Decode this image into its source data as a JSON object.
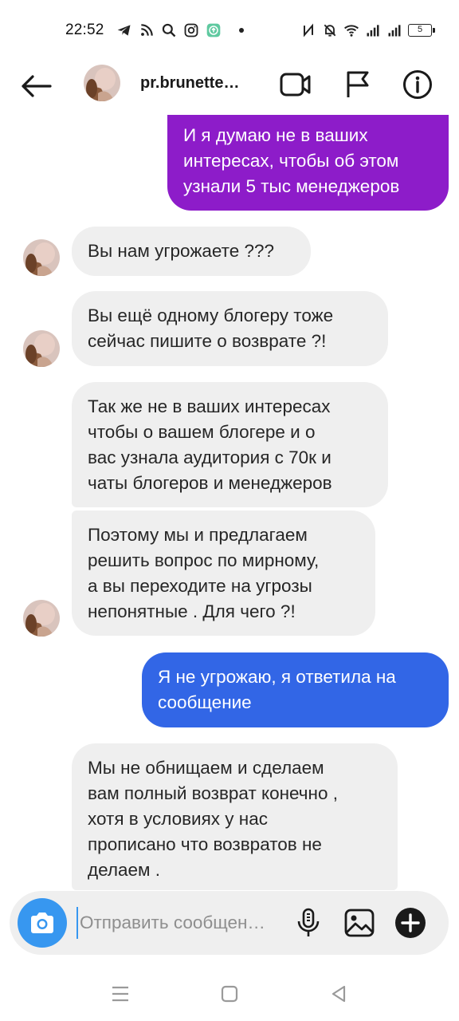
{
  "status_bar": {
    "time": "22:52",
    "battery": "5",
    "icons_left": [
      "telegram-icon",
      "rss-icon",
      "search-icon",
      "instagram-icon",
      "app-update-icon"
    ],
    "icons_right": [
      "nfc-icon",
      "mute-bell-icon",
      "wifi-icon",
      "signal-icon",
      "signal-icon",
      "battery-icon"
    ]
  },
  "header": {
    "username": "pr.brunette…",
    "actions": [
      "video-call-icon",
      "flag-icon",
      "info-icon"
    ]
  },
  "messages": [
    {
      "direction": "outgoing",
      "color": "#8d1cc9",
      "lines": [
        "И  я думаю не в ваших",
        "интересах, чтобы об этом",
        "узнали 5 тыс менеджеров"
      ]
    },
    {
      "direction": "incoming",
      "lines": [
        "Вы нам угрожаете ???"
      ]
    },
    {
      "direction": "incoming",
      "lines": [
        "Вы ещё одному блогеру тоже",
        "сейчас пишите о возврате ?!"
      ]
    },
    {
      "direction": "incoming",
      "lines": [
        "Так же не в ваших интересах",
        "чтобы о вашем блогере и о",
        "вас узнала аудитория с 70к и",
        "чаты блогеров и менеджеров"
      ]
    },
    {
      "direction": "incoming",
      "lines": [
        "Поэтому мы и предлагаем",
        "решить вопрос по мирному,",
        "а вы переходите на угрозы",
        "непонятные . Для чего ?!"
      ]
    },
    {
      "direction": "outgoing",
      "color": "#3266e6",
      "lines": [
        "Я не угрожаю, я ответила на",
        "сообщение"
      ]
    },
    {
      "direction": "incoming",
      "lines": [
        "Мы не обнищаем и сделаем",
        "вам полный возврат конечно ,",
        "хотя в условиях у нас",
        "прописано что возвратов не",
        "делаем ."
      ]
    }
  ],
  "composer": {
    "placeholder": "Отправить сообщен…",
    "value": ""
  },
  "colors": {
    "accent": "#3797f0",
    "outgoing_purple": "#8d1cc9",
    "outgoing_blue": "#3266e6",
    "incoming_bubble": "#efefef"
  }
}
